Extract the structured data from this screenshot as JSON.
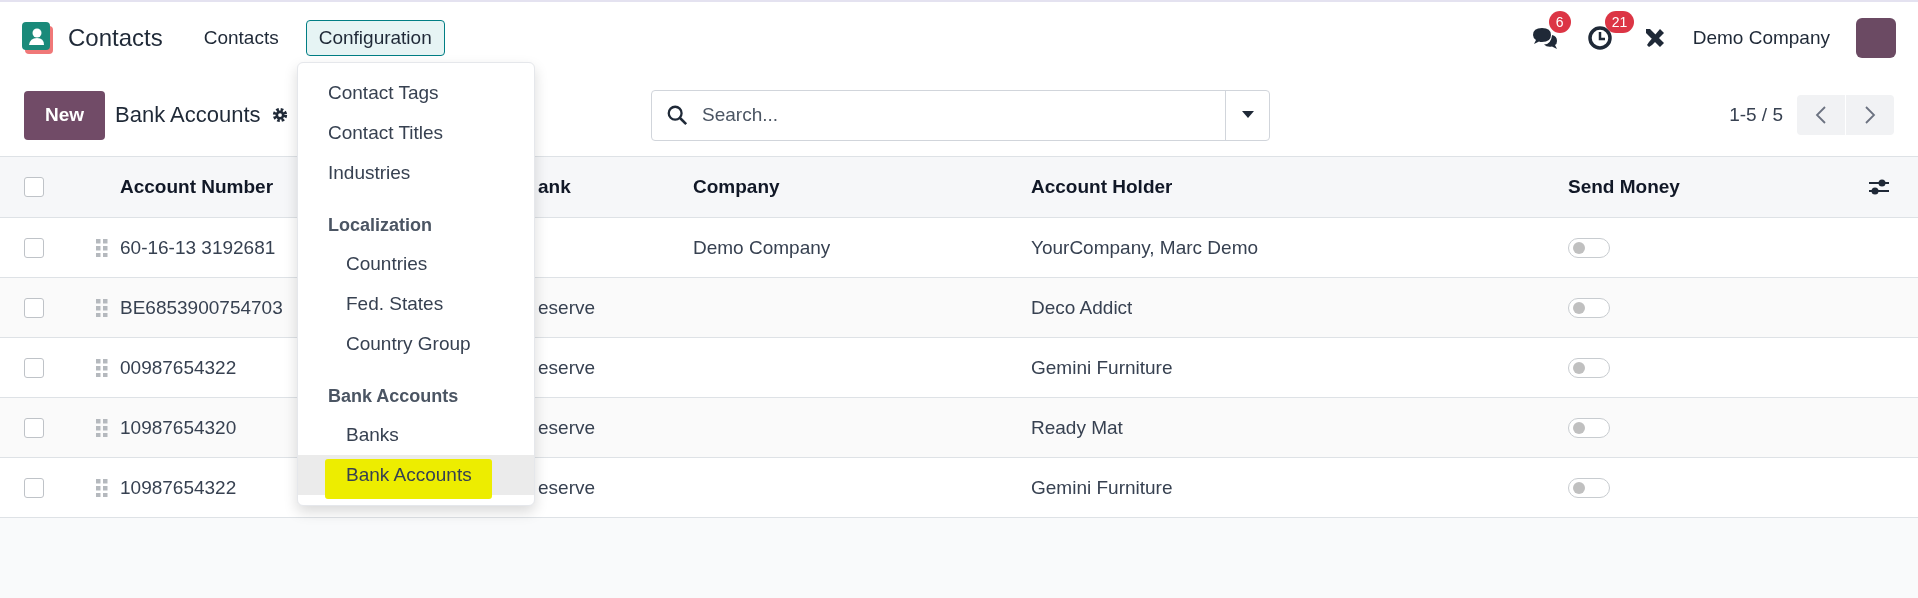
{
  "app_title": "Contacts",
  "nav_menus": [
    {
      "label": "Contacts",
      "expanded": false
    },
    {
      "label": "Configuration",
      "expanded": true
    }
  ],
  "systray": {
    "messages_count": "6",
    "activities_count": "21",
    "company": "Demo Company"
  },
  "control_panel": {
    "new_button": "New",
    "breadcrumb": "Bank Accounts",
    "search": {
      "placeholder": "Search..."
    },
    "pager": "1-5 / 5"
  },
  "config_menu": {
    "items": [
      {
        "label": "Contact Tags",
        "selected": false,
        "highlighted": false
      },
      {
        "label": "Contact Titles",
        "selected": false,
        "highlighted": false
      },
      {
        "label": "Industries",
        "selected": false,
        "highlighted": false
      }
    ],
    "sections": [
      {
        "title": "Localization",
        "items": [
          {
            "label": "Countries",
            "selected": false,
            "highlighted": false
          },
          {
            "label": "Fed. States",
            "selected": false,
            "highlighted": false
          },
          {
            "label": "Country Group",
            "selected": false,
            "highlighted": false
          }
        ]
      },
      {
        "title": "Bank Accounts",
        "items": [
          {
            "label": "Banks",
            "selected": false,
            "highlighted": false
          },
          {
            "label": "Bank Accounts",
            "selected": true,
            "highlighted": true
          }
        ]
      }
    ]
  },
  "table": {
    "select_all": {
      "checked": false
    },
    "columns": [
      "Account Number",
      "ank",
      "Company",
      "Account Holder",
      "Send Money"
    ],
    "rows": [
      {
        "checked": false,
        "account_number": "60-16-13 3192681",
        "bank": "",
        "company": "Demo Company",
        "account_holder": "YourCompany, Marc Demo",
        "send_money": false
      },
      {
        "checked": false,
        "account_number": "BE6853900754703",
        "bank": "eserve",
        "company": "",
        "account_holder": "Deco Addict",
        "send_money": false
      },
      {
        "checked": false,
        "account_number": "00987654322",
        "bank": "eserve",
        "company": "",
        "account_holder": "Gemini Furniture",
        "send_money": false
      },
      {
        "checked": false,
        "account_number": "10987654320",
        "bank": "eserve",
        "company": "",
        "account_holder": "Ready Mat",
        "send_money": false
      },
      {
        "checked": false,
        "account_number": "10987654322",
        "bank": "eserve",
        "company": "",
        "account_holder": "Gemini Furniture",
        "send_money": false
      }
    ]
  }
}
